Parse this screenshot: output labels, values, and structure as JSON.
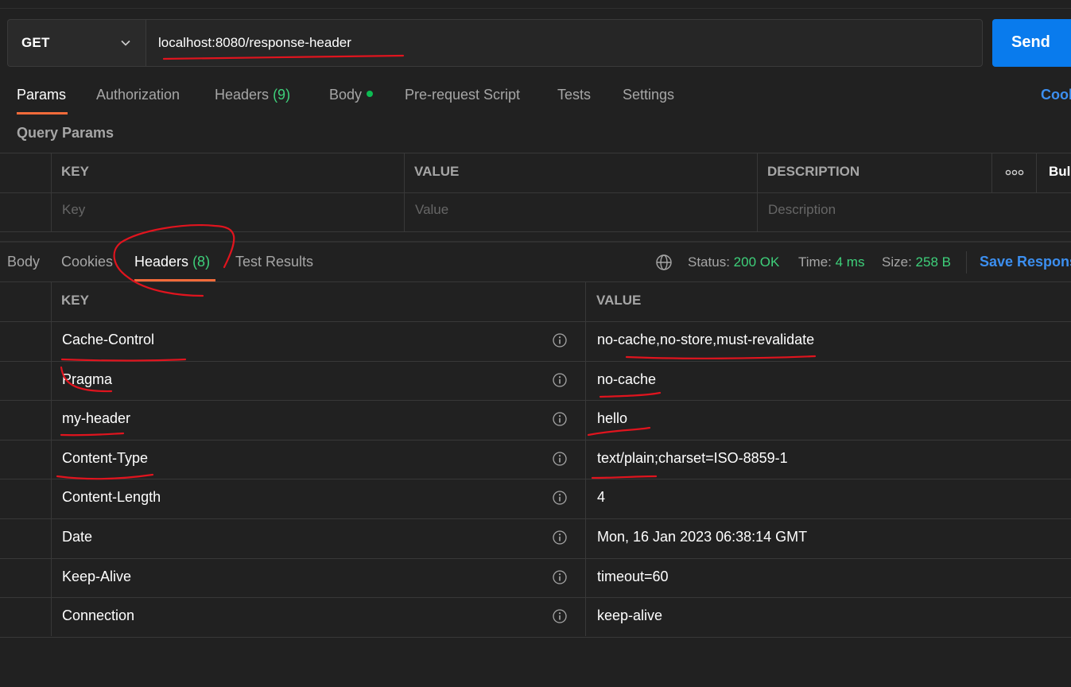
{
  "request": {
    "method": "GET",
    "url": "localhost:8080/response-header",
    "send_label": "Send"
  },
  "request_tabs": {
    "params": "Params",
    "authorization": "Authorization",
    "headers": "Headers",
    "headers_count": "(9)",
    "body": "Body",
    "prerequest": "Pre-request Script",
    "tests": "Tests",
    "settings": "Settings",
    "cookies": "Cookies"
  },
  "query_params": {
    "title": "Query Params",
    "columns": {
      "key": "KEY",
      "value": "VALUE",
      "description": "DESCRIPTION"
    },
    "bulk_edit": "Bulk Edit",
    "placeholders": {
      "key": "Key",
      "value": "Value",
      "description": "Description"
    }
  },
  "response": {
    "tabs": {
      "body": "Body",
      "cookies": "Cookies",
      "headers": "Headers",
      "headers_count": "(8)",
      "test_results": "Test Results"
    },
    "status_label": "Status:",
    "status_value": "200 OK",
    "time_label": "Time:",
    "time_value": "4 ms",
    "size_label": "Size:",
    "size_value": "258 B",
    "save_label": "Save Response",
    "columns": {
      "key": "KEY",
      "value": "VALUE"
    },
    "headers": [
      {
        "key": "Cache-Control",
        "value": "no-cache,no-store,must-revalidate"
      },
      {
        "key": "Pragma",
        "value": "no-cache"
      },
      {
        "key": "my-header",
        "value": "hello"
      },
      {
        "key": "Content-Type",
        "value": "text/plain;charset=ISO-8859-1"
      },
      {
        "key": "Content-Length",
        "value": "4"
      },
      {
        "key": "Date",
        "value": "Mon, 16 Jan 2023 06:38:14 GMT"
      },
      {
        "key": "Keep-Alive",
        "value": "timeout=60"
      },
      {
        "key": "Connection",
        "value": "keep-alive"
      }
    ]
  },
  "colors": {
    "background": "#212121",
    "accent_orange": "#f26b3a",
    "send_blue": "#097bed",
    "link_blue": "#3c8ff0",
    "status_green": "#3ed07a",
    "annotation_red": "#e0141e"
  },
  "icons": [
    "chevron-down-icon",
    "more-icon",
    "globe-icon",
    "info-icon"
  ]
}
